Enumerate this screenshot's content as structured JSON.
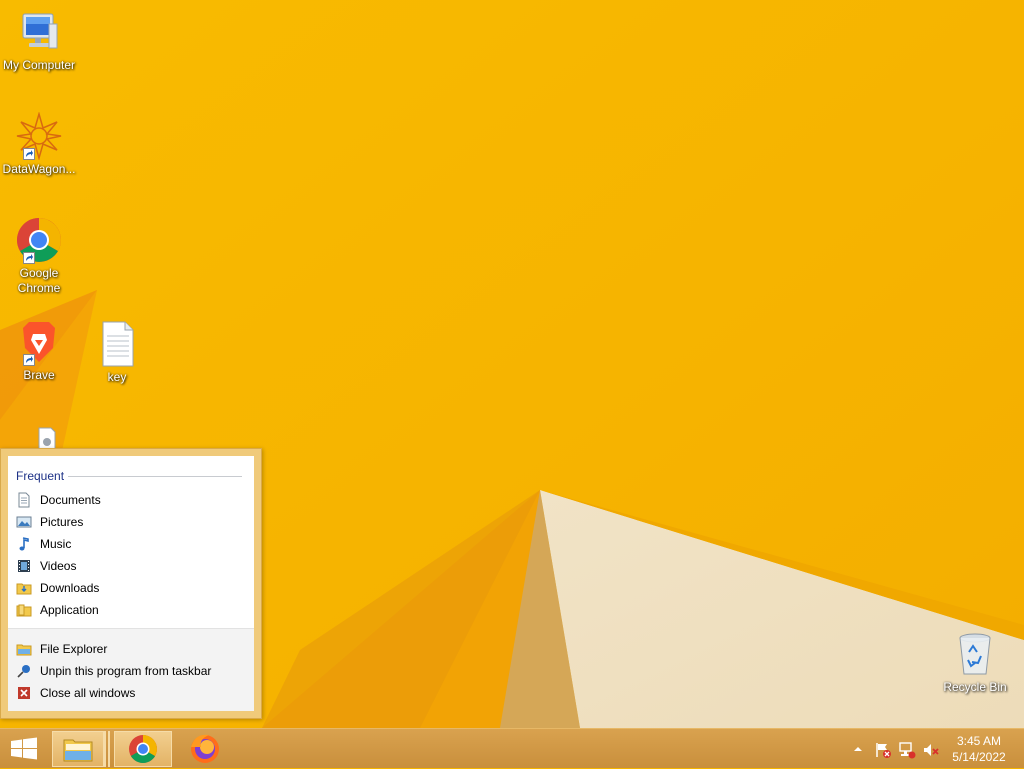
{
  "desktop": {
    "icons": [
      {
        "label": "My Computer"
      },
      {
        "label": "DataWagon..."
      },
      {
        "label": "Google Chrome"
      },
      {
        "label": "Brave"
      },
      {
        "label": "key"
      },
      {
        "label": "Recycle Bin"
      }
    ]
  },
  "jumplist": {
    "section_title": "Frequent",
    "frequent": [
      {
        "label": "Documents",
        "icon": "documents-icon"
      },
      {
        "label": "Pictures",
        "icon": "pictures-icon"
      },
      {
        "label": "Music",
        "icon": "music-icon"
      },
      {
        "label": "Videos",
        "icon": "videos-icon"
      },
      {
        "label": "Downloads",
        "icon": "downloads-folder-icon"
      },
      {
        "label": "Application",
        "icon": "folder-icon"
      }
    ],
    "tasks": [
      {
        "label": "File Explorer",
        "icon": "file-explorer-icon"
      },
      {
        "label": "Unpin this program from taskbar",
        "icon": "unpin-icon"
      },
      {
        "label": "Close all windows",
        "icon": "close-windows-icon"
      }
    ]
  },
  "taskbar": {
    "clock_time": "3:45 AM",
    "clock_date": "5/14/2022",
    "pinned": [
      "file-explorer",
      "google-chrome",
      "firefox"
    ]
  },
  "colors": {
    "wallpaper_primary": "#f6b400",
    "jumplist_accent": "#1e3287",
    "taskbar": "#c98f3c"
  }
}
